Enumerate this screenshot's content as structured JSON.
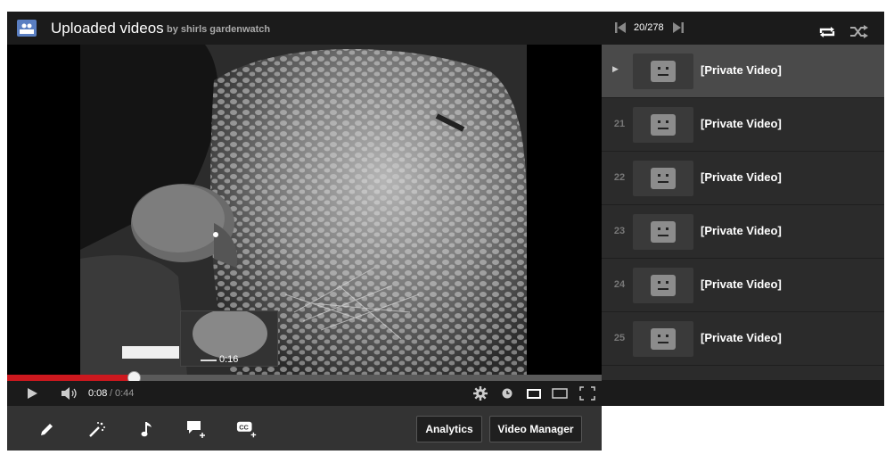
{
  "header": {
    "title": "Uploaded videos",
    "by": "by shirls gardenwatch"
  },
  "player": {
    "current_time": "0:08",
    "separator": "/",
    "total_time": "0:44",
    "progress": 0.215,
    "preview_time": "0:16"
  },
  "edit_toolbar": {
    "icons": [
      "pencil-icon",
      "magic-wand-icon",
      "music-note-icon",
      "annotation-icon",
      "captions-icon"
    ],
    "analytics_label": "Analytics",
    "video_manager_label": "Video Manager"
  },
  "playlist": {
    "position": "20/278",
    "items": [
      {
        "index": "",
        "title": "[Private Video]",
        "active": true
      },
      {
        "index": "21",
        "title": "[Private Video]",
        "active": false
      },
      {
        "index": "22",
        "title": "[Private Video]",
        "active": false
      },
      {
        "index": "23",
        "title": "[Private Video]",
        "active": false
      },
      {
        "index": "24",
        "title": "[Private Video]",
        "active": false
      },
      {
        "index": "25",
        "title": "[Private Video]",
        "active": false
      }
    ]
  },
  "colors": {
    "progress": "#cc181e",
    "header_bg": "#1b1b1b",
    "playlist_bg": "#2b2b2b",
    "playlist_active_bg": "#4a4a4a"
  }
}
